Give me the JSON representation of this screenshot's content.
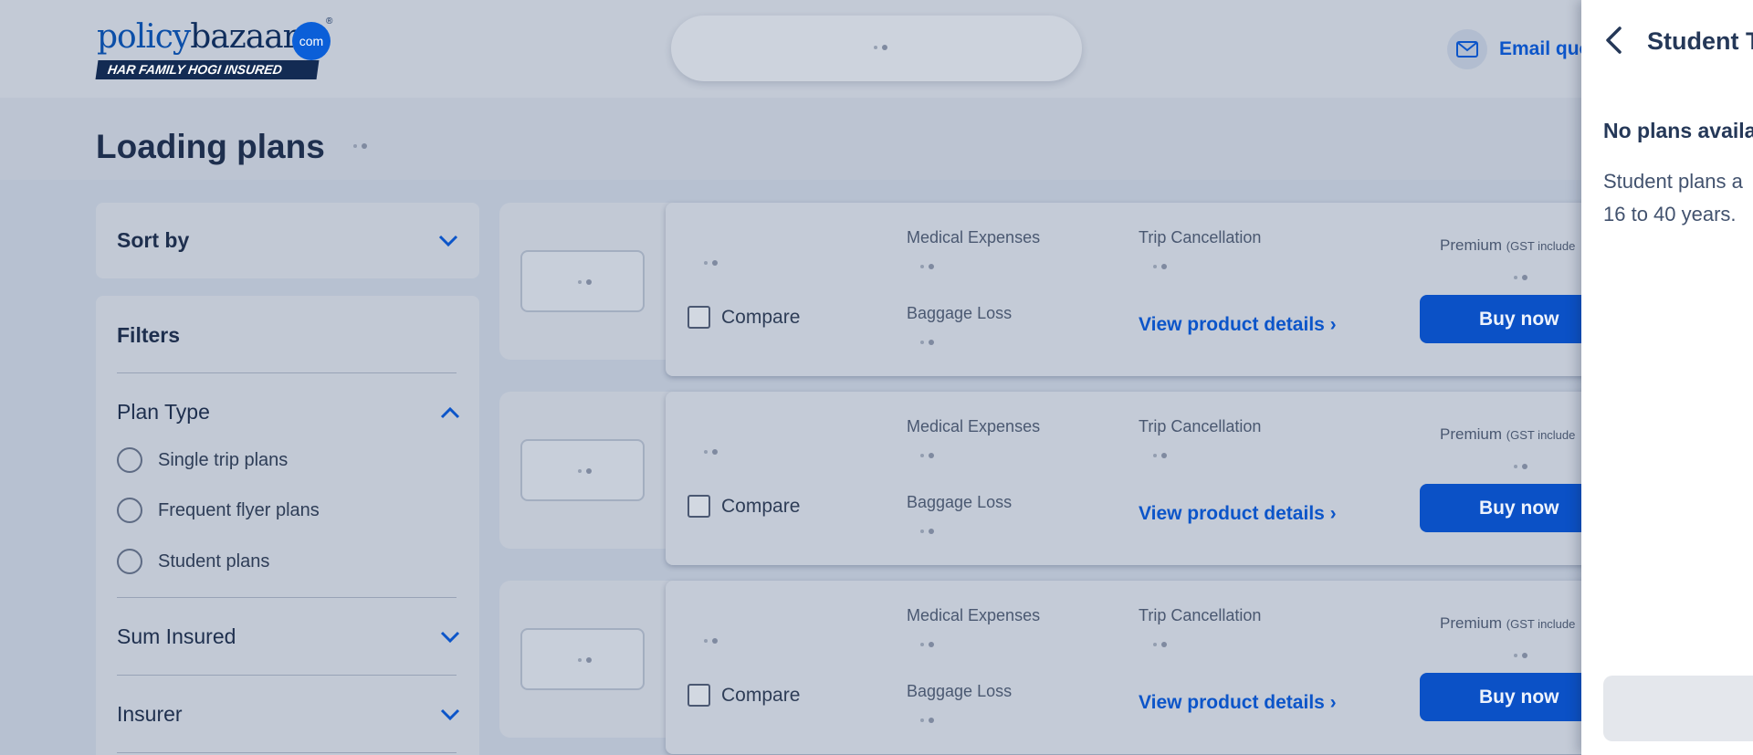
{
  "header": {
    "logo": {
      "word_a": "policy",
      "word_b": "bazaar",
      "dot_com": "com",
      "reg": "®",
      "tagline": "HAR FAMILY HOGI INSURED"
    },
    "email_label": "Email quo"
  },
  "page": {
    "title": "Loading plans"
  },
  "sidebar": {
    "sort_label": "Sort by",
    "filters_title": "Filters",
    "plan_type": {
      "title": "Plan Type",
      "options": [
        "Single trip plans",
        "Frequent flyer plans",
        "Student plans"
      ]
    },
    "sum_insured_title": "Sum Insured",
    "insurer_title": "Insurer"
  },
  "plans": [
    {
      "compare_label": "Compare",
      "medical_label": "Medical Expenses",
      "trip_label": "Trip Cancellation",
      "baggage_label": "Baggage Loss",
      "view_details": "View product details ›",
      "premium_label": "Premium",
      "premium_note": "(GST include",
      "buy_label": "Buy now"
    },
    {
      "compare_label": "Compare",
      "medical_label": "Medical Expenses",
      "trip_label": "Trip Cancellation",
      "baggage_label": "Baggage Loss",
      "view_details": "View product details ›",
      "premium_label": "Premium",
      "premium_note": "(GST include",
      "buy_label": "Buy now"
    },
    {
      "compare_label": "Compare",
      "medical_label": "Medical Expenses",
      "trip_label": "Trip Cancellation",
      "baggage_label": "Baggage Loss",
      "view_details": "View product details ›",
      "premium_label": "Premium",
      "premium_note": "(GST include",
      "buy_label": "Buy now"
    }
  ],
  "drawer": {
    "title": "Student T",
    "heading": "No plans availa",
    "text_line1": "Student plans a",
    "text_line2": "16 to 40 years."
  },
  "colors": {
    "brand_blue": "#0b51c6",
    "link_blue": "#0c55c9",
    "text_dark": "#253858"
  }
}
